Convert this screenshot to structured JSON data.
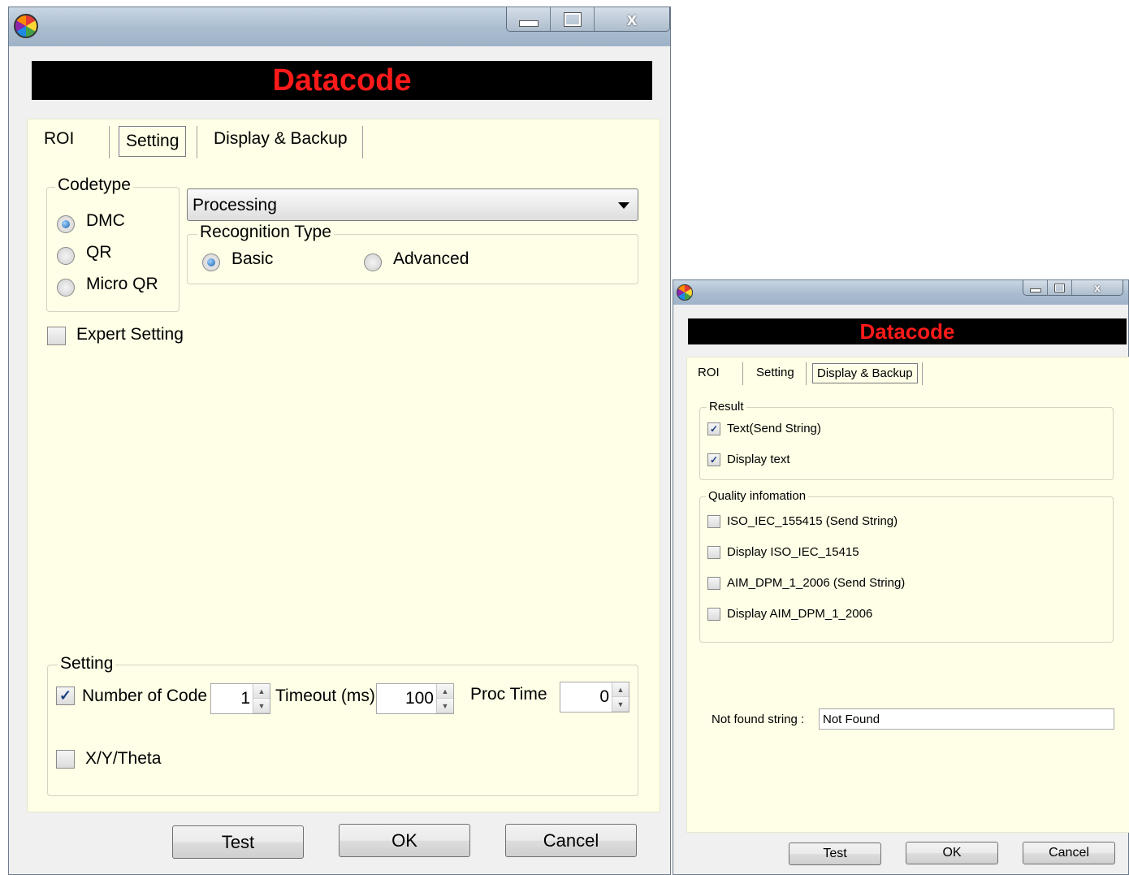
{
  "window1": {
    "banner": "Datacode",
    "tabs": [
      "ROI",
      "Setting",
      "Display & Backup"
    ],
    "codetype": {
      "legend": "Codetype",
      "options": [
        "DMC",
        "QR",
        "Micro QR"
      ],
      "selected": "DMC"
    },
    "processing": {
      "value": "Processing"
    },
    "recognition": {
      "legend": "Recognition Type",
      "options": [
        "Basic",
        "Advanced"
      ],
      "selected": "Basic"
    },
    "expert_setting": {
      "label": "Expert Setting",
      "checked": false
    },
    "setting": {
      "legend": "Setting",
      "number_of_code": {
        "label": "Number of Code",
        "checked": true,
        "value": "1"
      },
      "timeout": {
        "label": "Timeout (ms)",
        "value": "100"
      },
      "proc_time": {
        "label": "Proc Time",
        "value": "0"
      },
      "xytheta": {
        "label": "X/Y/Theta",
        "checked": false
      }
    },
    "buttons": {
      "test": "Test",
      "ok": "OK",
      "cancel": "Cancel"
    }
  },
  "window2": {
    "banner": "Datacode",
    "tabs": [
      "ROI",
      "Setting",
      "Display & Backup"
    ],
    "result": {
      "legend": "Result",
      "items": [
        {
          "label": "Text(Send String)",
          "checked": true
        },
        {
          "label": "Display text",
          "checked": true
        }
      ]
    },
    "quality": {
      "legend": "Quality infomation",
      "items": [
        {
          "label": "ISO_IEC_155415 (Send String)",
          "checked": false
        },
        {
          "label": "Display ISO_IEC_15415",
          "checked": false
        },
        {
          "label": "AIM_DPM_1_2006 (Send String)",
          "checked": false
        },
        {
          "label": "Display AIM_DPM_1_2006",
          "checked": false
        }
      ]
    },
    "not_found": {
      "label": "Not found string :",
      "value": "Not Found"
    },
    "buttons": {
      "test": "Test",
      "ok": "OK",
      "cancel": "Cancel"
    }
  },
  "colors": {
    "banner_text": "#ff1a1a",
    "panel_bg": "#fffee6",
    "accent": "#1b5fa8"
  },
  "icons": {
    "app": "app-logo-icon",
    "minimize": "minimize-icon",
    "maximize": "maximize-icon",
    "close": "close-icon"
  }
}
